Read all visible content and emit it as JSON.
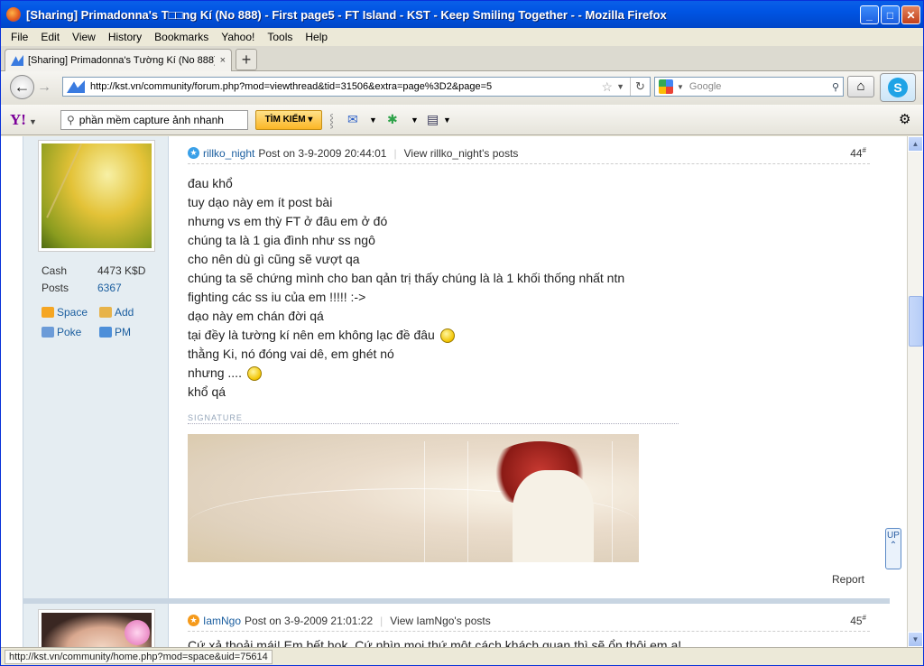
{
  "window": {
    "title": "[Sharing] Primadonna's T□□ng Kí (No 888) - First page5 - FT Island - KST - Keep Smiling Together - - Mozilla Firefox"
  },
  "menu": [
    "File",
    "Edit",
    "View",
    "History",
    "Bookmarks",
    "Yahoo!",
    "Tools",
    "Help"
  ],
  "tab": {
    "label": "[Sharing] Primadonna's Tường Kí (No 888) - ...",
    "close": "×",
    "new": "+"
  },
  "nav": {
    "url": "http://kst.vn/community/forum.php?mod=viewthread&tid=31506&extra=page%3D2&page=5",
    "search_placeholder": "Google"
  },
  "yahoo": {
    "logo": "Y!",
    "search_value": "phần mềm capture ảnh nhanh",
    "search_button": "TÌM KIẾM ▾"
  },
  "post1": {
    "stats": [
      {
        "label": "Cash",
        "value": "4473 K$D"
      },
      {
        "label": "Posts",
        "value": "6367"
      }
    ],
    "links": [
      "Space",
      "Add",
      "Poke",
      "PM"
    ],
    "user": "rillko_night",
    "posted": "Post on 3-9-2009 20:44:01",
    "view": "View rillko_night's posts",
    "number": "44",
    "lines": [
      "đau khổ",
      "tuy dạo này em ít post bài",
      "nhưng vs em thỳ FT ở đâu em ở đó",
      "chúng ta là 1 gia đình như ss ngô",
      "cho nên dù gì cũng sẽ vượt qa",
      "chúng ta sẽ chứng mình cho ban qản trị thấy chúng là là 1 khối thống nhất ntn",
      "fighting các ss iu của em !!!!! :->",
      "dạo này em chán đời qá",
      "tại đềy là tường kí nên em không lạc đề đâu",
      "thằng Ki, nó đóng vai dê, em ghét nó",
      "nhưng ....",
      "khổ qá"
    ],
    "signature_label": "SIGNATURE",
    "report": "Report"
  },
  "post2": {
    "user": "IamNgo",
    "posted": "Post on 3-9-2009 21:01:22",
    "view": "View IamNgo's posts",
    "number": "45",
    "text": "Cứ xả thoải mái! Em bết hok..Cứ nhìn mọi thứ một cách khách quan thì sẽ ổn thôi em a!"
  },
  "up_button": "UP",
  "status": {
    "link": "http://kst.vn/community/home.php?mod=space&uid=75614"
  }
}
